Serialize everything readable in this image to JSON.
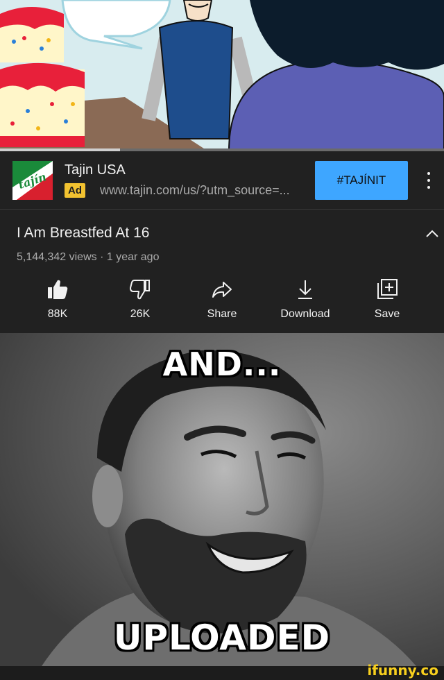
{
  "video": {
    "progress": 0.27,
    "progress_color": "#cfcfcf"
  },
  "ad": {
    "advertiser": "Tajin USA",
    "badge": "Ad",
    "url": "www.tajin.com/us/?utm_source=...",
    "cta": "#TAJÍNIT",
    "logo_text": "tajín",
    "accent": "#3ea6ff",
    "badge_color": "#f2c230"
  },
  "title": {
    "text": "I Am Breastfed At 16",
    "meta": "5,144,342 views · 1 year ago"
  },
  "actions": [
    {
      "icon": "thumbs-up-filled-icon",
      "label": "88K"
    },
    {
      "icon": "thumbs-down-icon",
      "label": "26K"
    },
    {
      "icon": "share-icon",
      "label": "Share"
    },
    {
      "icon": "download-icon",
      "label": "Download"
    },
    {
      "icon": "save-to-playlist-icon",
      "label": "Save"
    }
  ],
  "meme": {
    "top_text": "AND...",
    "bottom_text": "UPLOADED"
  },
  "watermark": "ifunny.co"
}
